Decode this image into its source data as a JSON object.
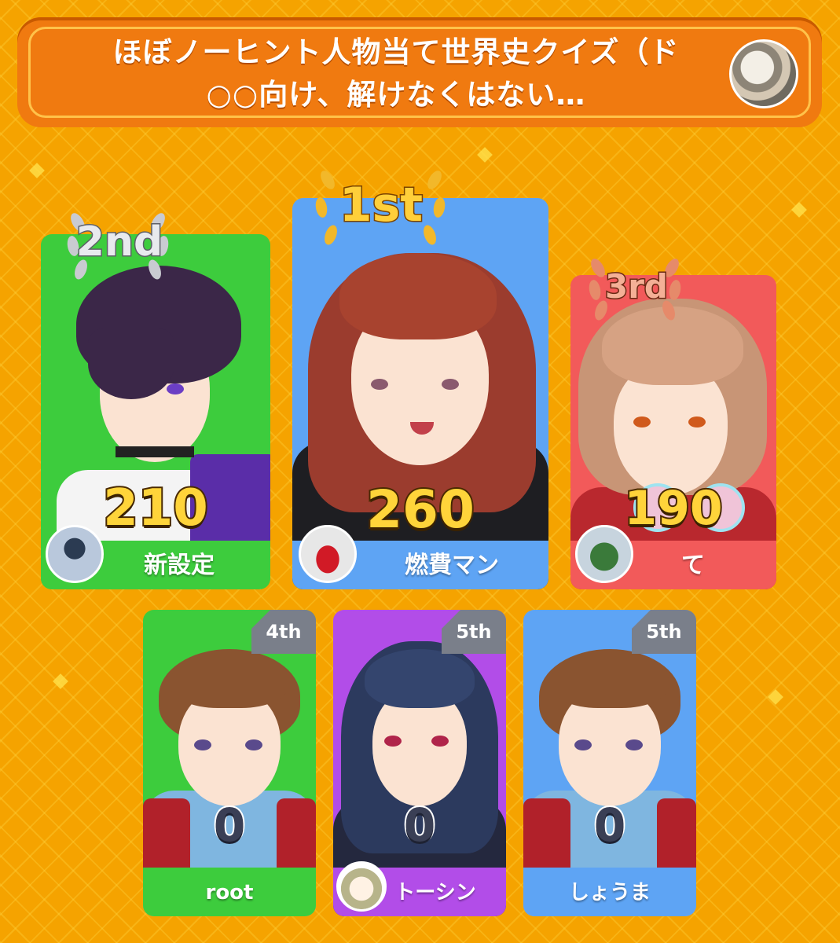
{
  "header": {
    "title": "ほぼノーヒント人物当て世界史クイズ（ド○○向け、解けなくはない…"
  },
  "podium": [
    {
      "rank": "1st",
      "score": "260",
      "name": "燃費マン",
      "color": "#5ea4f4"
    },
    {
      "rank": "2nd",
      "score": "210",
      "name": "新設定",
      "color": "#3dcc3d"
    },
    {
      "rank": "3rd",
      "score": "190",
      "name": "て",
      "color": "#f25a5a"
    }
  ],
  "others": [
    {
      "rank": "4th",
      "score": "0",
      "name": "root",
      "color": "#3dcc3d"
    },
    {
      "rank": "5th",
      "score": "0",
      "name": "トーシン",
      "color": "#b24de8"
    },
    {
      "rank": "5th",
      "score": "0",
      "name": "しょうま",
      "color": "#5ea4f4"
    }
  ],
  "colors": {
    "background": "#f5a300",
    "header": "#f07a10",
    "gold": "#ffd43a",
    "rank_tab": "#7a7f8a"
  }
}
